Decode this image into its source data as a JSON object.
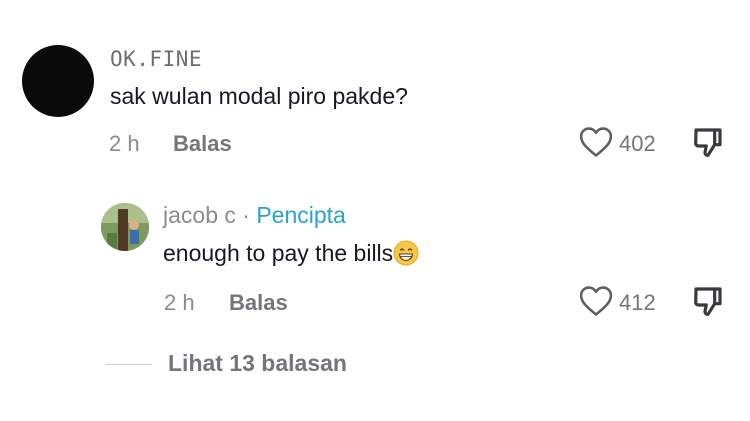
{
  "comment": {
    "username": "OK.FINE",
    "text": "sak wulan modal piro pakde?",
    "time": "2 h",
    "reply_label": "Balas",
    "likes": "402",
    "icons": {
      "like": "heart-outline-icon",
      "dislike": "thumbs-down-icon"
    }
  },
  "reply": {
    "username": "jacob c",
    "separator": "·",
    "badge": "Pencipta",
    "text": "enough to pay the bills",
    "emoji": "grinning-face-with-smiling-eyes",
    "time": "2 h",
    "reply_label": "Balas",
    "likes": "412"
  },
  "view_replies": "Lihat 13 balasan",
  "colors": {
    "creator_badge": "#2aa3c9",
    "secondary_text": "#8a8b91",
    "primary_text": "#161823"
  }
}
